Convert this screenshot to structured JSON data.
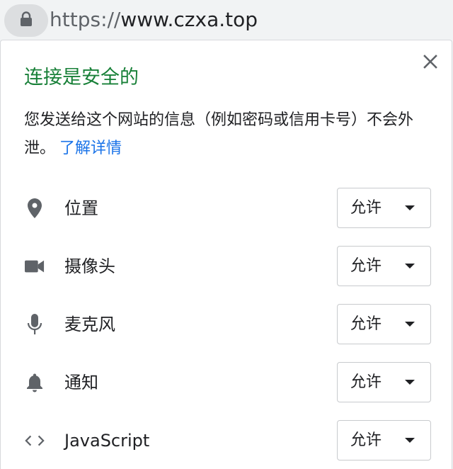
{
  "urlbar": {
    "scheme": "https://",
    "host": "www.czxa.top"
  },
  "popup": {
    "title": "连接是安全的",
    "description": "您发送给这个网站的信息（例如密码或信用卡号）不会外泄。",
    "learn_more": "了解详情",
    "permissions": [
      {
        "label": "位置",
        "icon": "location-pin-icon",
        "value": "允许"
      },
      {
        "label": "摄像头",
        "icon": "camera-icon",
        "value": "允许"
      },
      {
        "label": "麦克风",
        "icon": "microphone-icon",
        "value": "允许"
      },
      {
        "label": "通知",
        "icon": "bell-icon",
        "value": "允许"
      },
      {
        "label": "JavaScript",
        "icon": "code-brackets-icon",
        "value": "允许"
      }
    ]
  },
  "colors": {
    "secure_green": "#188038",
    "link_blue": "#1a73e8",
    "icon_gray": "#5f6368"
  }
}
